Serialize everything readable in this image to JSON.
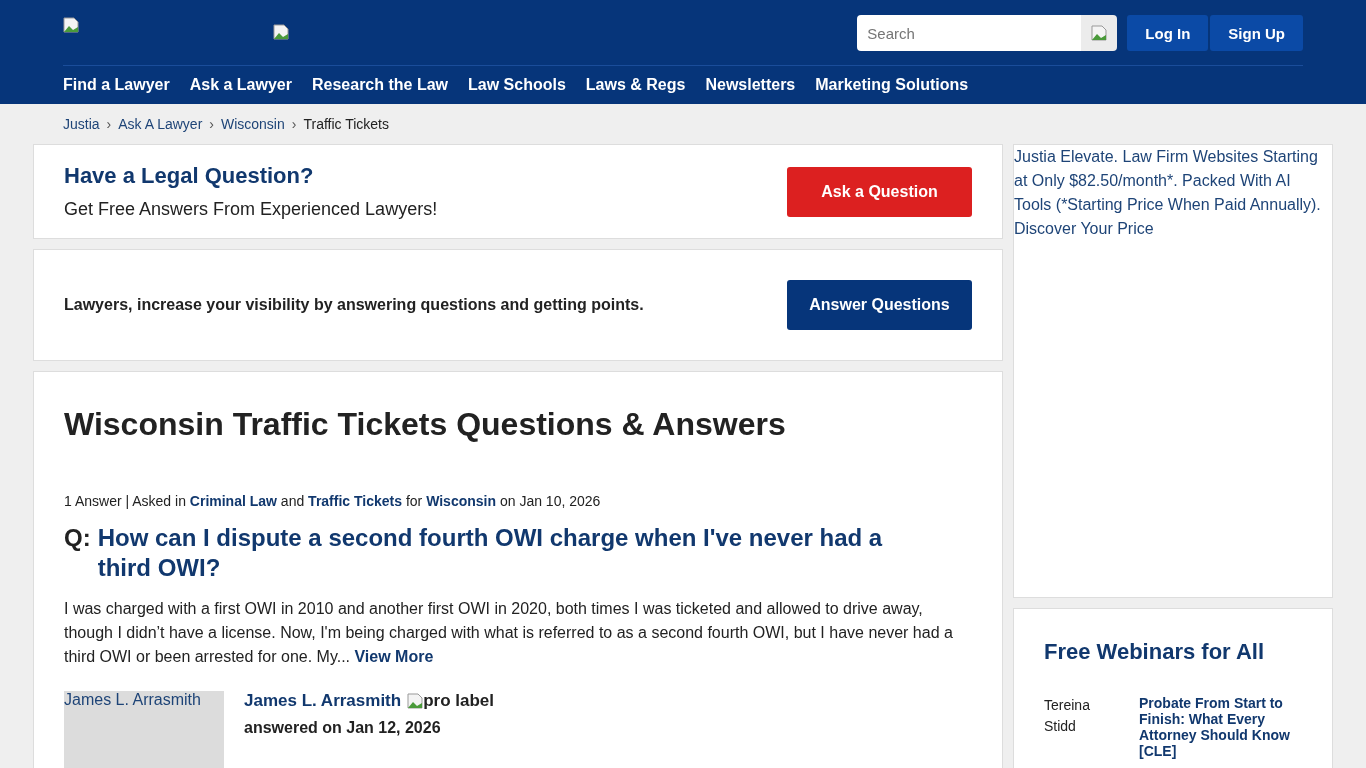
{
  "header": {
    "search": {
      "placeholder": "Search"
    },
    "buttons": [
      "Log In",
      "Sign Up"
    ],
    "nav": [
      "Find a Lawyer",
      "Ask a Lawyer",
      "Research the Law",
      "Law Schools",
      "Laws & Regs",
      "Newsletters",
      "Marketing Solutions"
    ]
  },
  "breadcrumbs": [
    {
      "kind": "link",
      "label": "Justia"
    },
    {
      "kind": "separator",
      "label": "›"
    },
    {
      "kind": "link",
      "label": "Ask A Lawyer"
    },
    {
      "kind": "separator",
      "label": "›"
    },
    {
      "kind": "link",
      "label": "Wisconsin"
    },
    {
      "kind": "separator",
      "label": "›"
    },
    {
      "kind": "current",
      "label": "Traffic Tickets"
    }
  ],
  "ask_card": {
    "title": "Have a Legal Question?",
    "subtitle": "Get Free Answers From Experienced Lawyers!",
    "button": "Ask a Question"
  },
  "lawyer_card": {
    "text": "Lawyers, increase your visibility by answering questions and getting points.",
    "button": "Answer Questions"
  },
  "page_title": "Wisconsin Traffic Tickets Questions & Answers",
  "question": {
    "meta": [
      {
        "kind": "text",
        "text": "1 Answer | Asked in"
      },
      {
        "kind": "link",
        "text": "Criminal Law"
      },
      {
        "kind": "text",
        "text": "and"
      },
      {
        "kind": "link",
        "text": "Traffic Tickets"
      },
      {
        "kind": "text",
        "text": "for"
      },
      {
        "kind": "link",
        "text": "Wisconsin"
      },
      {
        "kind": "text",
        "text": "on Jan 10, 2026"
      }
    ],
    "prefix": "Q:",
    "title": "How can I dispute a second fourth OWI charge when I've never had a third OWI?",
    "body": "I was charged with a first OWI in 2010 and another first OWI in 2020, both times I was ticketed and allowed to drive away, though I didn’t have a license. Now, I'm being charged with what is referred to as a second fourth OWI, but I have never had a third OWI or been arrested for one. My...",
    "more": "View More",
    "answer": {
      "photo_alt": "James L. Arrasmith",
      "name": "James L. Arrasmith",
      "badge_alt": "pro label",
      "date": "answered on Jan 12, 2026"
    }
  },
  "ad": {
    "alt": "Justia Elevate. Law Firm Websites Starting at Only $82.50/month*. Packed With AI Tools (*Starting Price When Paid Annually). Discover Your Price"
  },
  "webinars": {
    "title": "Free Webinars for All",
    "items": [
      {
        "photo_alt": "Tereina Stidd",
        "title": "Probate From Start to Finish: What Every Attorney Should Know [CLE]"
      }
    ]
  }
}
